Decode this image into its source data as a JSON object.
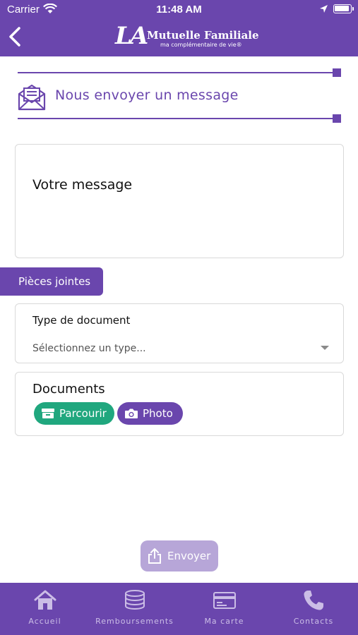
{
  "status_bar": {
    "carrier": "Carrier",
    "time": "11:48 AM"
  },
  "header": {
    "logo_mark": "LA",
    "logo_name": "Mutuelle Familiale",
    "logo_tagline": "ma complémentaire de vie®",
    "back_icon": "chevron-left-icon"
  },
  "section": {
    "title": "Nous envoyer un message",
    "icon": "mail-open-icon"
  },
  "message": {
    "placeholder": "Votre message",
    "value": ""
  },
  "attachments": {
    "tab_label": "Pièces jointes",
    "type_label": "Type de document",
    "type_placeholder": "Sélectionnez un type...",
    "documents_label": "Documents",
    "browse_label": "Parcourir",
    "photo_label": "Photo"
  },
  "send_label": "Envoyer",
  "tabbar": {
    "items": [
      {
        "label": "Accueil",
        "icon": "home-icon"
      },
      {
        "label": "Remboursements",
        "icon": "coins-icon"
      },
      {
        "label": "Ma carte",
        "icon": "card-icon"
      },
      {
        "label": "Contacts",
        "icon": "phone-icon"
      }
    ]
  },
  "colors": {
    "primary": "#6a46ad",
    "green": "#20a77e",
    "send_disabled": "#b7a6d8",
    "tab_label": "#cbbde6"
  }
}
